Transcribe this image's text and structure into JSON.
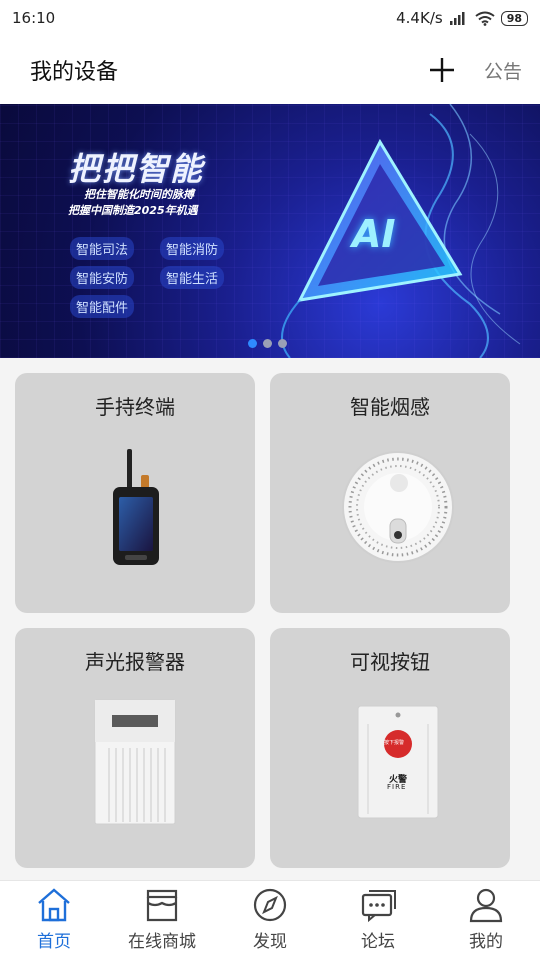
{
  "status": {
    "time": "16:10",
    "speed": "4.4K/s",
    "battery": "98"
  },
  "header": {
    "title": "我的设备",
    "notice": "公告"
  },
  "banner": {
    "title": "把把智能",
    "sub1": "把住智能化时间的脉搏",
    "sub2": "把握中国制造2025年机遇",
    "ai": "AI",
    "tags": [
      "智能司法",
      "智能消防",
      "智能安防",
      "智能生活",
      "智能配件"
    ]
  },
  "devices": [
    {
      "label": "手持终端"
    },
    {
      "label": "智能烟感"
    },
    {
      "label": "声光报警器"
    },
    {
      "label": "可视按钮"
    }
  ],
  "button_device": {
    "tag": "按下报警",
    "fire_cn": "火警",
    "fire_en": "FIRE"
  },
  "tabs": [
    {
      "label": "首页",
      "icon": "home-icon"
    },
    {
      "label": "在线商城",
      "icon": "store-icon"
    },
    {
      "label": "发现",
      "icon": "compass-icon"
    },
    {
      "label": "论坛",
      "icon": "chat-icon"
    },
    {
      "label": "我的",
      "icon": "user-icon"
    }
  ],
  "colors": {
    "accent": "#1e6fd9",
    "card": "#d3d3d3"
  }
}
